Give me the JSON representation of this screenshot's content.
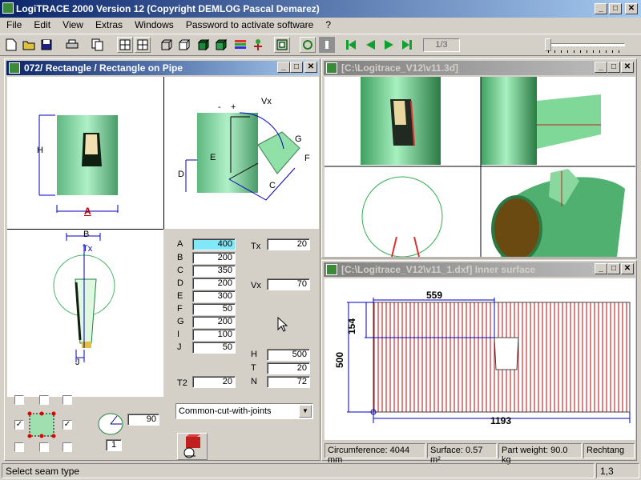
{
  "app": {
    "title": "LogiTRACE 2000  Version 12  (Copyright DEMLOG Pascal Demarez)",
    "min": "_",
    "max": "□",
    "close": "✕"
  },
  "menu": [
    "File",
    "Edit",
    "View",
    "Extras",
    "Windows",
    "Password to activate software",
    "?"
  ],
  "toolbar": {
    "page_indicator": "1/3",
    "icons": [
      "new-icon",
      "open-icon",
      "save-icon",
      "print-icon",
      "copy-icon",
      "layout-icon",
      "wireframe-icon",
      "box-icon",
      "solid-icon",
      "shaded-icon",
      "color-icon",
      "tree-icon",
      "frame-icon",
      "circle-icon",
      "info-icon",
      "first-icon",
      "prev-icon",
      "next-icon",
      "last-icon"
    ]
  },
  "left_window": {
    "title": "072/ Rectangle / Rectangle on Pipe",
    "labels": {
      "A": "A",
      "B": "B",
      "C": "C",
      "D": "D",
      "E": "E",
      "F": "F",
      "G": "G",
      "H": "H",
      "J": "J",
      "Tx": "Tx",
      "Vx": "Vx",
      "plus": "+",
      "minus": "-"
    },
    "params": [
      {
        "label": "A",
        "value": "400"
      },
      {
        "label": "B",
        "value": "200"
      },
      {
        "label": "C",
        "value": "350"
      },
      {
        "label": "D",
        "value": "200"
      },
      {
        "label": "E",
        "value": "300"
      },
      {
        "label": "F",
        "value": "50"
      },
      {
        "label": "G",
        "value": "200"
      },
      {
        "label": "I",
        "value": "100"
      },
      {
        "label": "J",
        "value": "50"
      }
    ],
    "tx": {
      "label": "Tx",
      "value": "20"
    },
    "vx": {
      "label": "Vx",
      "value": "70"
    },
    "h": {
      "label": "H",
      "value": "500"
    },
    "t": {
      "label": "T",
      "value": "20"
    },
    "n": {
      "label": "N",
      "value": "72"
    },
    "t2": {
      "label": "T2",
      "value": "20"
    },
    "seam_select": "Common-cut-with-joints",
    "angle_value": "90",
    "count_value": "1"
  },
  "view3d_window": {
    "title": "[C:\\Logitrace_V12\\v11.3d]"
  },
  "dxf_window": {
    "title": "[C:\\Logitrace_V12\\v11_1.dxf]  Inner surface",
    "dims": {
      "d559": "559",
      "d154": "154",
      "d500": "500",
      "d1193": "1193"
    },
    "status": [
      "Circumference: 4044 mm",
      "Surface: 0.57 m²",
      "Part weight: 90.0 kg",
      "Rechtang"
    ]
  },
  "statusbar": {
    "message": "Select seam type",
    "code": "1,3"
  },
  "colors": {
    "accent": "#0a246a",
    "pipe": "#7fd3a0",
    "dim_blue": "#0000c0",
    "stripe_red": "#c00000"
  }
}
